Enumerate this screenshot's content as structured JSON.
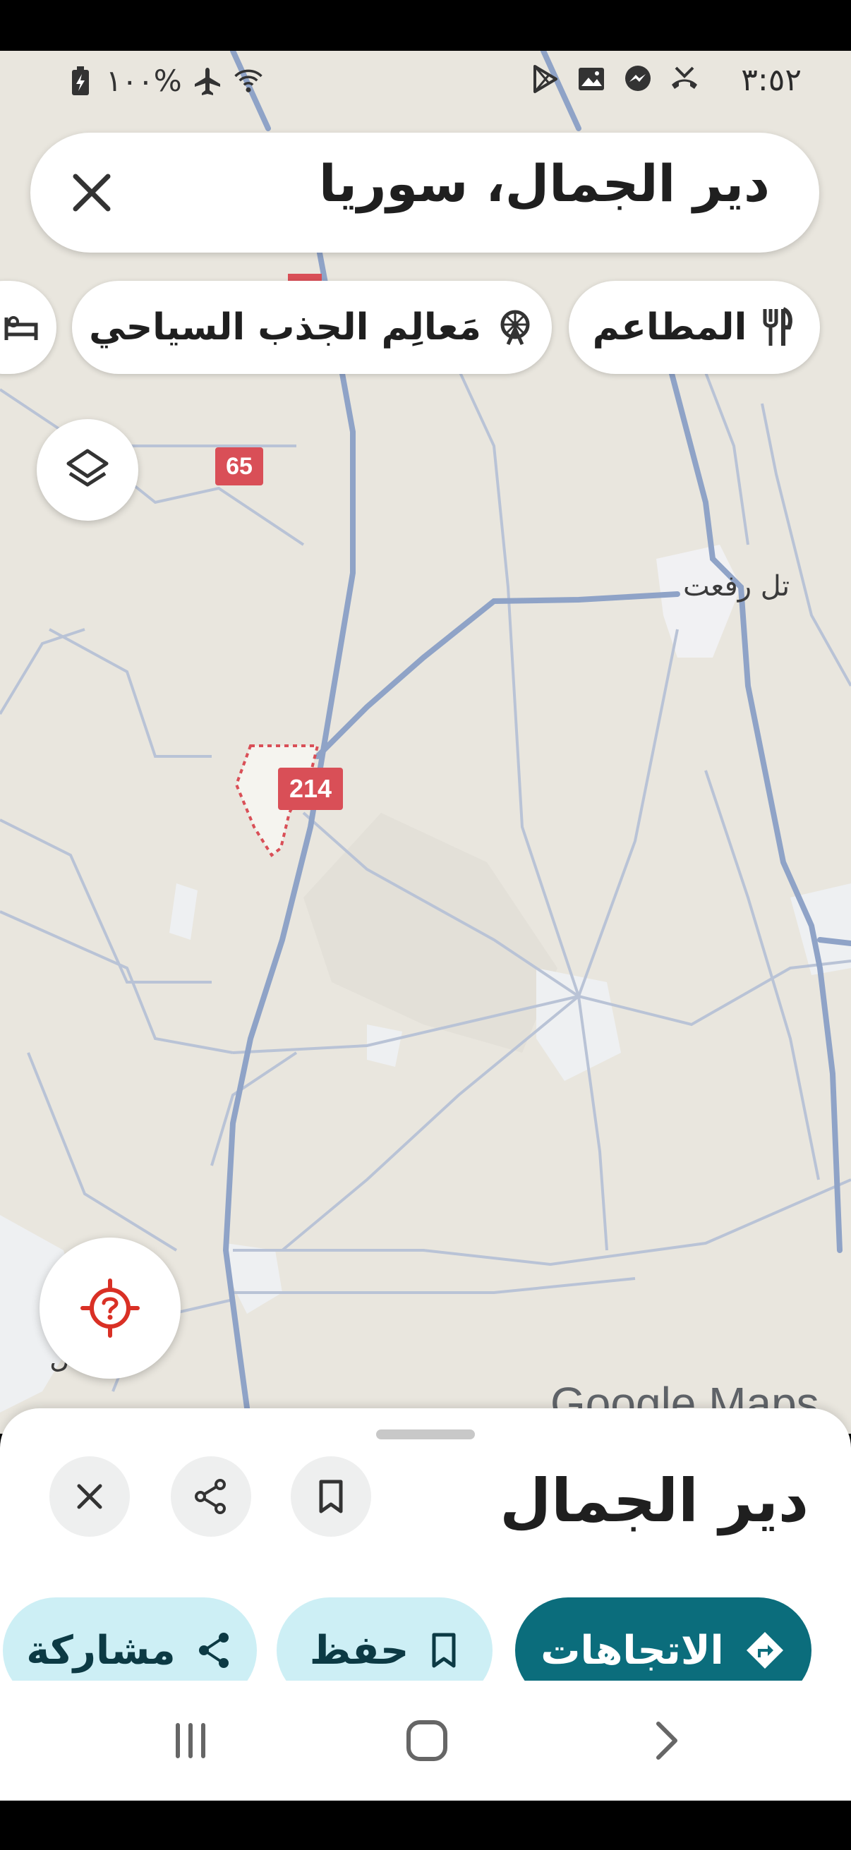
{
  "status_bar": {
    "time": "٣:٥٢",
    "battery": "%١٠٠"
  },
  "search": {
    "title": "دير الجمال، سوريا"
  },
  "chips": [
    {
      "label": "المطاعم",
      "icon": "restaurant-icon"
    },
    {
      "label": "مَعالِم الجذب السياحي",
      "icon": "attractions-icon"
    },
    {
      "label": "",
      "icon": "hotel-icon"
    }
  ],
  "map": {
    "route_65": "65",
    "route_214": "214",
    "place_tel_rifaat": "تل رفعت",
    "place_partial": "ل",
    "watermark": "Google Maps"
  },
  "sheet": {
    "title": "دير الجمال",
    "actions": {
      "directions": "الاتجاهات",
      "save": "حفظ",
      "share": "مشاركة"
    }
  },
  "colors": {
    "accent": "#0b6d7c",
    "secondary_bg": "#cdeff5",
    "route_shield": "#d94f57",
    "road": "#8fa3c7"
  }
}
